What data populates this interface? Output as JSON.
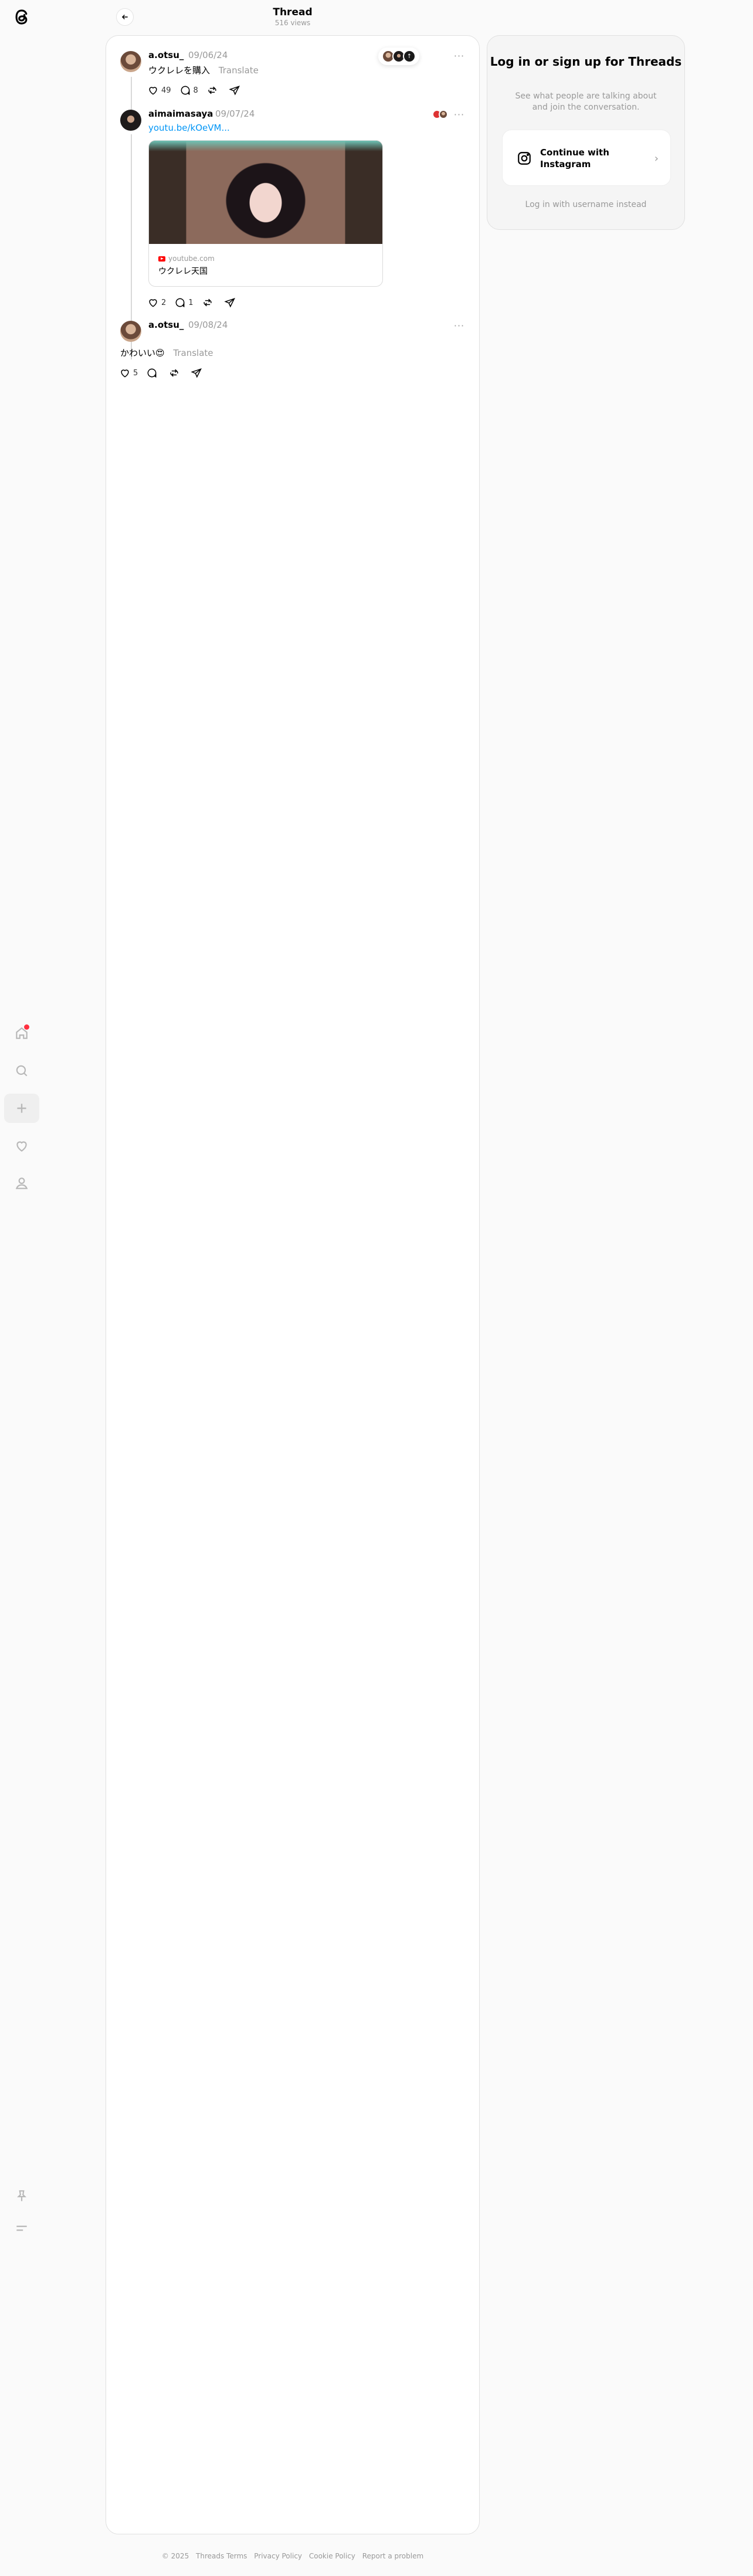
{
  "app": {
    "logo_icon": "threads-logo-icon"
  },
  "nav": {
    "items": [
      {
        "name": "home",
        "icon": "home-icon",
        "has_notification": true
      },
      {
        "name": "search",
        "icon": "search-icon"
      },
      {
        "name": "create",
        "icon": "plus-icon"
      },
      {
        "name": "activity",
        "icon": "heart-icon"
      },
      {
        "name": "profile",
        "icon": "person-icon"
      }
    ],
    "bottom": [
      {
        "name": "pin",
        "icon": "pin-icon"
      },
      {
        "name": "menu",
        "icon": "menu-icon"
      }
    ]
  },
  "header": {
    "title": "Thread",
    "views": "516 views"
  },
  "posts": [
    {
      "username": "a.otsu_",
      "date": "09/06/24",
      "text": "ウクレレを購入",
      "translate": "Translate",
      "likes": "49",
      "replies": "8",
      "reposts": "",
      "shares": ""
    },
    {
      "username": "aimaimasaya",
      "date": "09/07/24",
      "link": "youtu.be/kOeVM...",
      "embed_domain": "youtube.com",
      "embed_title": "ウクレレ天国",
      "likes": "2",
      "replies": "1",
      "reposts": "",
      "shares": ""
    },
    {
      "username": "a.otsu_",
      "date": "09/08/24",
      "text": "かわいい😍",
      "translate": "Translate",
      "likes": "5",
      "replies": "",
      "reposts": "",
      "shares": ""
    }
  ],
  "login": {
    "title": "Log in or sign up for Threads",
    "subtitle": "See what people are talking about and join the conversation.",
    "instagram_button": "Continue with Instagram",
    "alt_login": "Log in with username instead"
  },
  "footer": {
    "items": [
      "© 2025",
      "Threads Terms",
      "Privacy Policy",
      "Cookie Policy",
      "Report a problem"
    ]
  },
  "colors": {
    "link": "#0095f6",
    "notification": "#ff3040",
    "muted": "#999999"
  }
}
